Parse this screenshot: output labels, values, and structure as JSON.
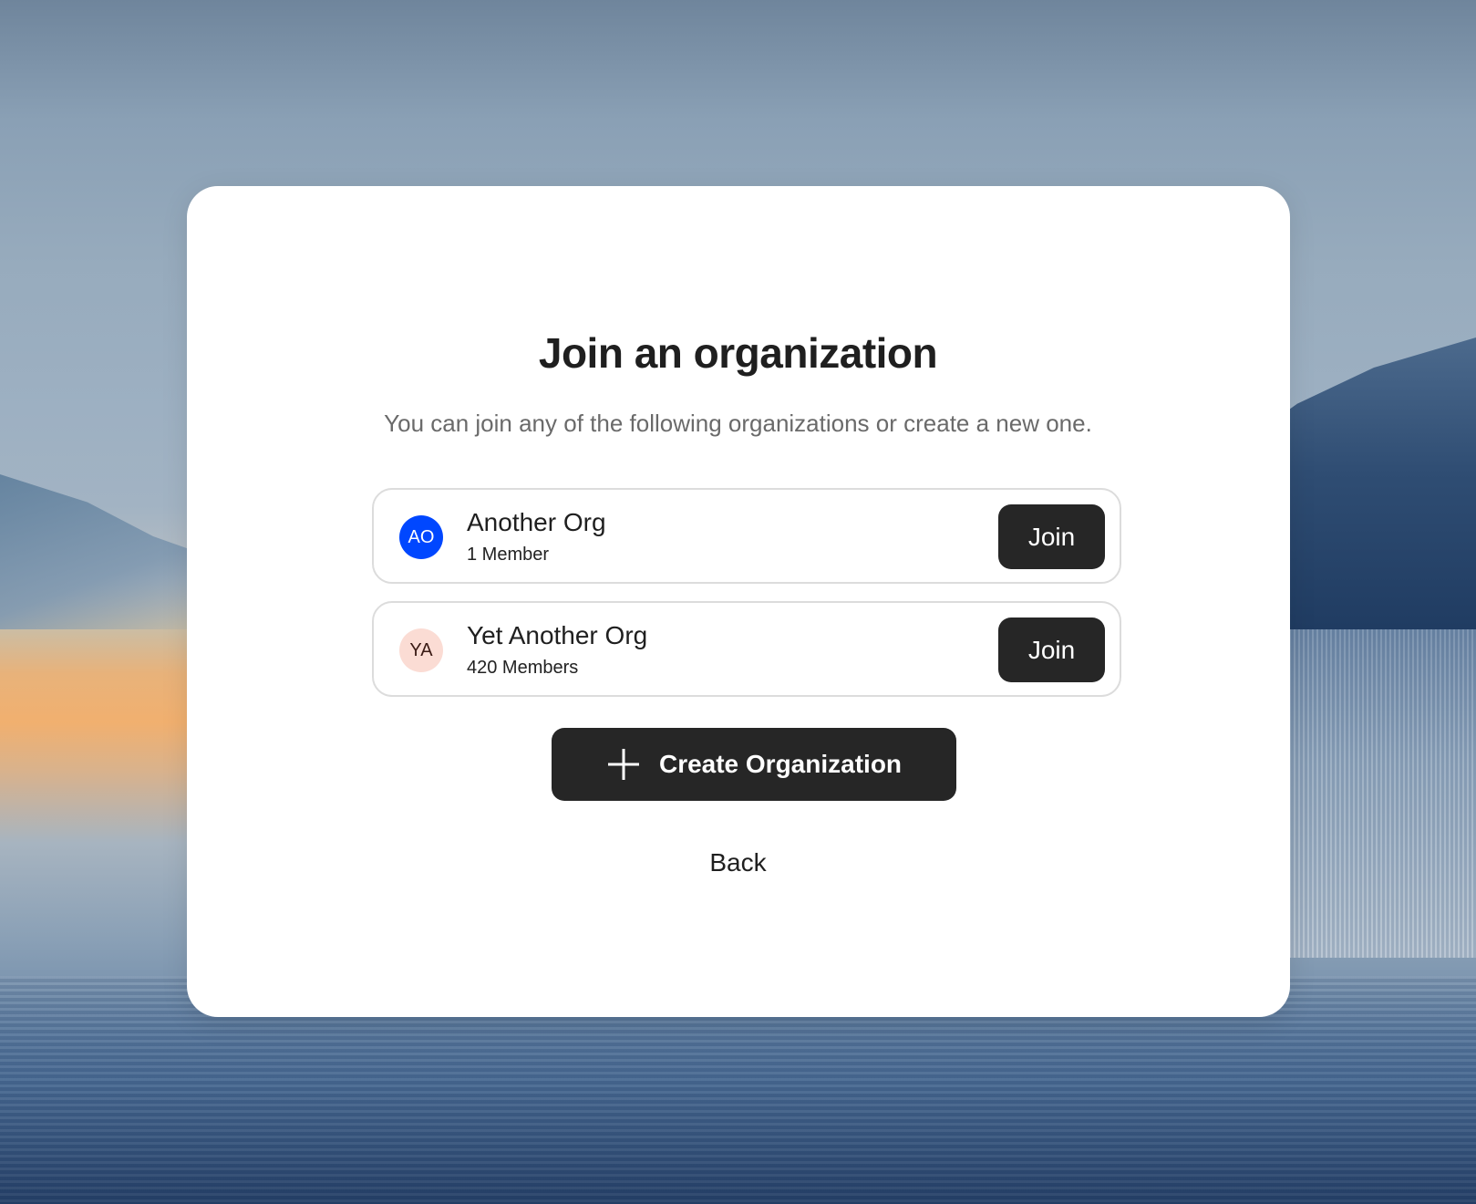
{
  "page": {
    "title": "Join an organization",
    "subtitle": "You can join any of the following organizations or create a new one."
  },
  "organizations": [
    {
      "initials": "AO",
      "name": "Another Org",
      "members": "1 Member",
      "join_label": "Join",
      "avatar_bg": "#0047ff",
      "avatar_fg": "#ffffff"
    },
    {
      "initials": "YA",
      "name": "Yet Another Org",
      "members": "420 Members",
      "join_label": "Join",
      "avatar_bg": "#fbdcd4",
      "avatar_fg": "#3a1a14"
    }
  ],
  "actions": {
    "create_label": "Create Organization",
    "create_icon": "plus-icon",
    "back_label": "Back"
  },
  "colors": {
    "button_bg": "#262626",
    "card_bg": "#ffffff"
  }
}
